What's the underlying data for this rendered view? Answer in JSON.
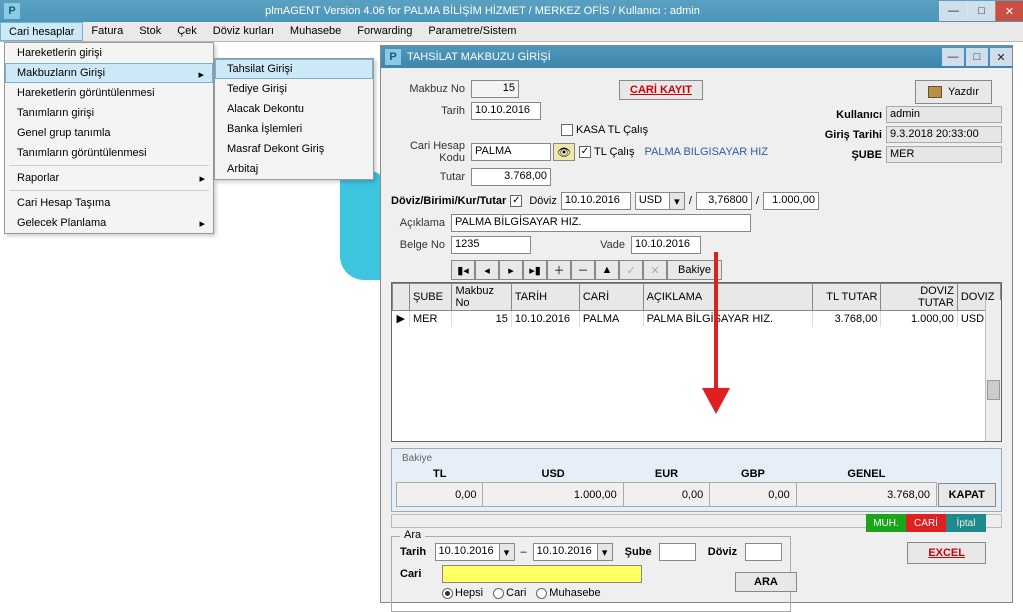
{
  "app": {
    "icon_letter": "P",
    "title": "plmAGENT  Version 4.06 for  PALMA BİLİŞİM HİZMET  /   MERKEZ OFİS /      Kullanıcı : admin"
  },
  "menubar": [
    "Cari hesaplar",
    "Fatura",
    "Stok",
    "Çek",
    "Döviz kurları",
    "Muhasebe",
    "Forwarding",
    "Parametre/Sistem"
  ],
  "dropdown1": {
    "items": [
      {
        "label": "Hareketlerin girişi",
        "sub": false
      },
      {
        "label": "Makbuzların Girişi",
        "sub": true,
        "hl": true
      },
      {
        "label": "Hareketlerin  görüntülenmesi",
        "sub": false
      },
      {
        "label": "Tanımların girişi",
        "sub": false
      },
      {
        "label": "Genel grup tanımla",
        "sub": false
      },
      {
        "label": "Tanımların görüntülenmesi",
        "sub": false
      },
      {
        "label": "__sep__"
      },
      {
        "label": "Raporlar",
        "sub": true
      },
      {
        "label": "__sep__"
      },
      {
        "label": "Cari Hesap Taşıma",
        "sub": false
      },
      {
        "label": "Gelecek Planlama",
        "sub": true
      }
    ]
  },
  "dropdown2": {
    "items": [
      {
        "label": "Tahsilat Girişi",
        "hl": true
      },
      {
        "label": "Tediye Girişi"
      },
      {
        "label": "Alacak Dekontu"
      },
      {
        "label": "Banka İşlemleri"
      },
      {
        "label": "Masraf Dekont Giriş"
      },
      {
        "label": "Arbitaj"
      }
    ]
  },
  "child": {
    "title": "TAHSİLAT MAKBUZU GİRİŞİ",
    "cari_kayit": "CARİ KAYIT",
    "yazdir": "Yazdır",
    "labels": {
      "makbuz_no": "Makbuz No",
      "tarih": "Tarih",
      "cari_hesap_kodu": "Cari Hesap Kodu",
      "tutar": "Tutar",
      "kasa_tl": "KASA TL Çalış",
      "tl_calis": "TL Çalış",
      "doviz_birimi": "Döviz/Birimi/Kur/Tutar",
      "doviz": "Döviz",
      "aciklama": "Açıklama",
      "belge_no": "Belge No",
      "vade": "Vade"
    },
    "values": {
      "makbuz_no": "15",
      "tarih": "10.10.2016",
      "cari_hesap_kodu": "PALMA",
      "cari_adi": "PALMA BILGISAYAR HIZ",
      "tutar": "3.768,00",
      "doviz_tarih": "10.10.2016",
      "doviz_birim": "USD",
      "kur": "3,76800",
      "doviz_tutar": "1.000,00",
      "aciklama": "PALMA BİLGİSAYAR HIZ.",
      "belge_no": "1235",
      "vade": "10.10.2016"
    },
    "info": {
      "kullanici_lbl": "Kullanıcı",
      "kullanici": "admin",
      "giris_tarihi_lbl": "Giriş Tarihi",
      "giris_tarihi": "9.3.2018 20:33:00",
      "sube_lbl": "ŞUBE",
      "sube": "MER"
    },
    "nav": {
      "bakiye": "Bakiye"
    },
    "grid": {
      "cols": [
        "",
        "ŞUBE",
        "Makbuz No",
        "TARİH",
        "CARİ",
        "AÇIKLAMA",
        "TL TUTAR",
        "DOVIZ TUTAR",
        "DOVIZ"
      ],
      "row": {
        "sube": "MER",
        "makbuz": "15",
        "tarih": "10.10.2016",
        "cari": "PALMA",
        "aciklama": "PALMA BİLGİSAYAR HIZ.",
        "tl": "3.768,00",
        "dvz_tut": "1.000,00",
        "dvz": "USD"
      }
    },
    "bakiye": {
      "title": "Bakiye",
      "cols": {
        "tl": "TL",
        "usd": "USD",
        "eur": "EUR",
        "gbp": "GBP",
        "genel": "GENEL"
      },
      "vals": {
        "tl": "0,00",
        "usd": "1.000,00",
        "eur": "0,00",
        "gbp": "0,00",
        "genel": "3.768,00"
      },
      "kapat": "KAPAT"
    },
    "ara": {
      "legend": "Ara",
      "tarih_lbl": "Tarih",
      "tarih1": "10.10.2016",
      "tarih2": "10.10.2016",
      "sube_lbl": "Şube",
      "doviz_lbl": "Döviz",
      "cari_lbl": "Cari",
      "hepsi": "Hepsi",
      "cari": "Cari",
      "muhasebe": "Muhasebe",
      "ara_btn": "ARA"
    },
    "buttons": {
      "muh": "MUH.",
      "cari": "CARİ",
      "iptal": "İptal",
      "excel": "EXCEL"
    }
  }
}
